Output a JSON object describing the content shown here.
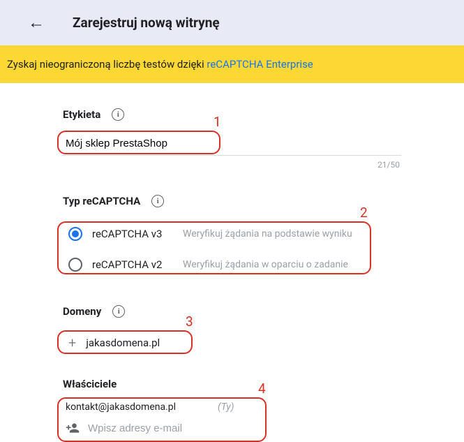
{
  "header": {
    "title": "Zarejestruj nową witrynę"
  },
  "banner": {
    "text": "Zyskaj nieograniczoną liczbę testów dzięki ",
    "link": "reCAPTCHA Enterprise"
  },
  "label_section": {
    "title": "Etykieta",
    "value": "Mój sklep PrestaShop",
    "count": "21/50"
  },
  "type_section": {
    "title": "Typ reCAPTCHA",
    "options": [
      {
        "label": "reCAPTCHA v3",
        "description": "Weryfikuj żądania na podstawie wyniku",
        "selected": true
      },
      {
        "label": "reCAPTCHA v2",
        "description": "Weryfikuj żądania w oparciu o zadanie",
        "selected": false
      }
    ]
  },
  "domains_section": {
    "title": "Domeny",
    "domain": "jakasdomena.pl"
  },
  "owners_section": {
    "title": "Właściciele",
    "email": "kontakt@jakasdomena.pl",
    "you_label": "(Ty)",
    "placeholder": "Wpisz adresy e-mail"
  },
  "annotations": {
    "n1": "1",
    "n2": "2",
    "n3": "3",
    "n4": "4"
  }
}
